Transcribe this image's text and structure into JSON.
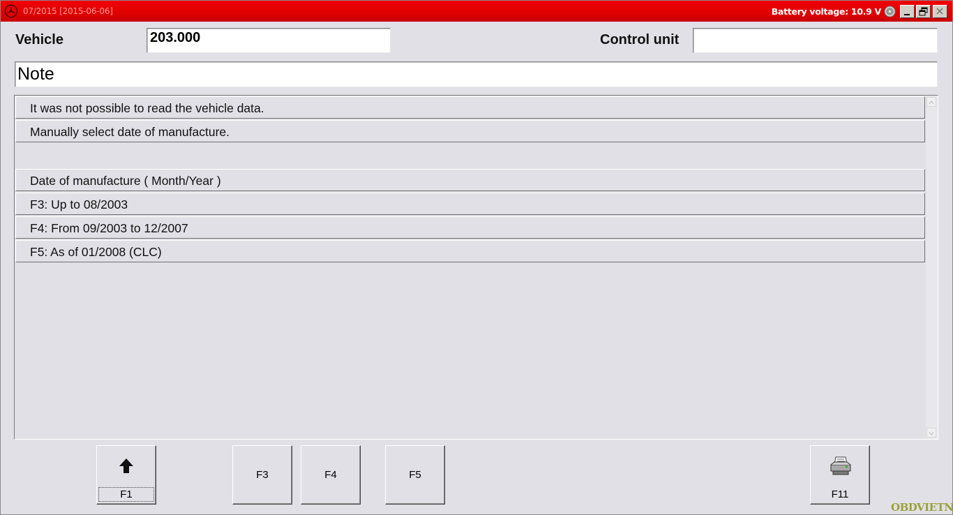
{
  "titlebar": {
    "title": "07/2015 [2015-06-06]",
    "battery": "Battery voltage: 10.9 V"
  },
  "header": {
    "vehicle_label": "Vehicle",
    "vehicle_value": "203.000",
    "control_unit_label": "Control unit",
    "control_unit_value": ""
  },
  "note": {
    "text": "Note"
  },
  "list": {
    "rows": [
      "It was not possible to read the vehicle data.",
      "Manually select date of manufacture.",
      "Date of manufacture ( Month/Year )",
      "F3: Up to 08/2003",
      "F4: From 09/2003 to 12/2007",
      "F5: As of 01/2008 (CLC)"
    ]
  },
  "buttons": {
    "f1": "F1",
    "f3": "F3",
    "f4": "F4",
    "f5": "F5",
    "f11": "F11"
  },
  "icons": {
    "logo": "mercedes-star-icon",
    "battery": "battery-icon",
    "f1": "up-arrow-icon",
    "f11": "printer-icon"
  },
  "watermark": "OBDVIETNAM"
}
